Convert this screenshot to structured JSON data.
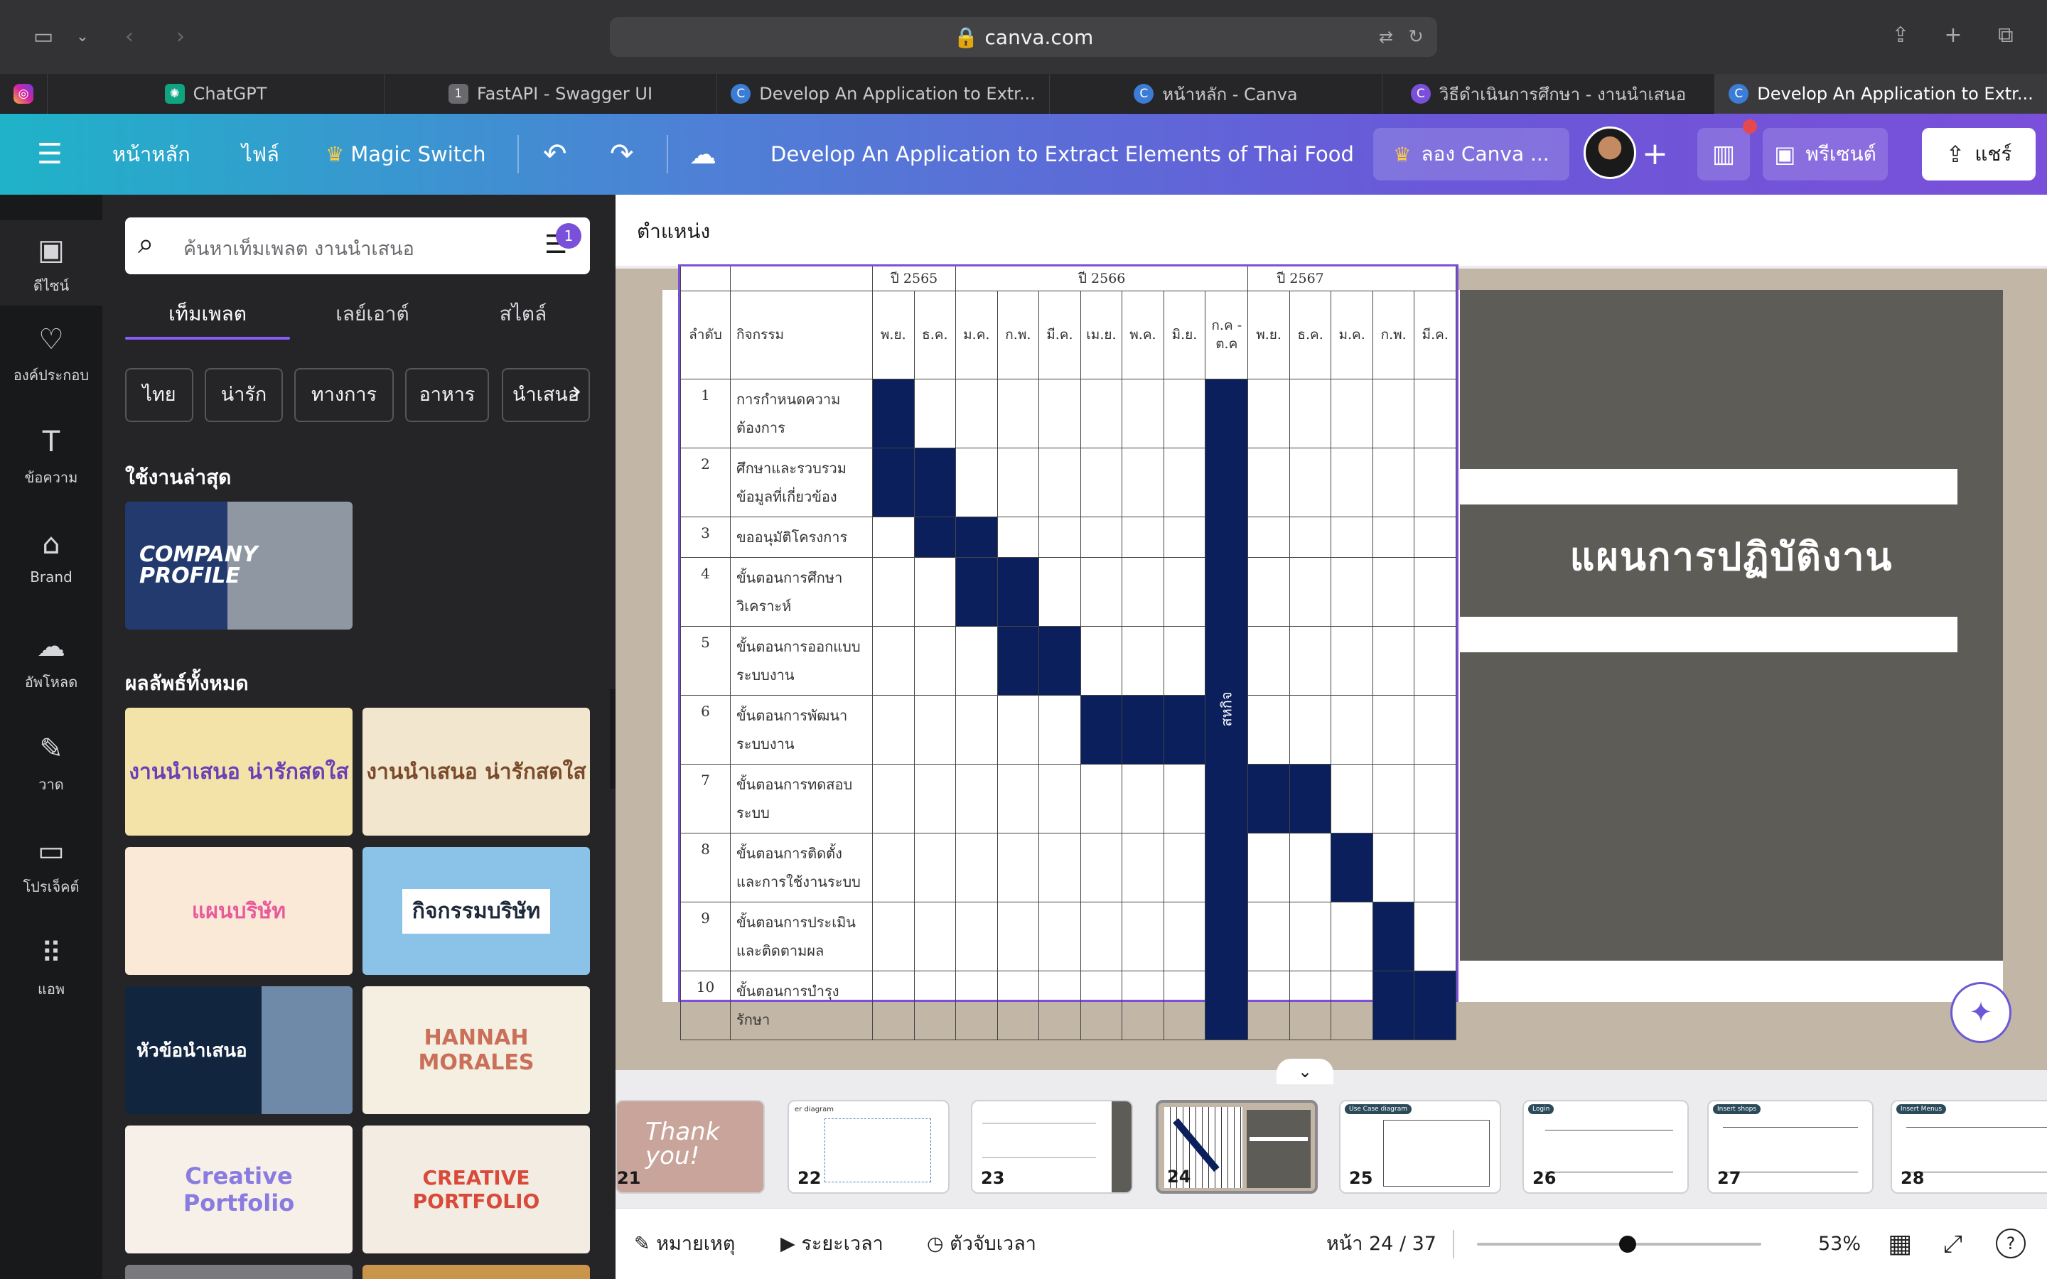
{
  "browser": {
    "url": "canva.com",
    "tabs": [
      {
        "label": "",
        "icon": "instagram-icon"
      },
      {
        "label": "ChatGPT",
        "icon": "chatgpt-icon"
      },
      {
        "label": "FastAPI - Swagger UI",
        "icon": "fastapi-icon"
      },
      {
        "label": "Develop An Application to Extr...",
        "icon": "canva-icon"
      },
      {
        "label": "หน้าหลัก - Canva",
        "icon": "canva-icon"
      },
      {
        "label": "วิธีดำเนินการศึกษา - งานนำเสนอ",
        "icon": "canva-icon"
      },
      {
        "label": "Develop An Application to Extr...",
        "icon": "canva-icon"
      }
    ]
  },
  "header": {
    "home": "หน้าหลัก",
    "file": "ไฟล์",
    "magic_switch": "Magic Switch",
    "doc_title": "Develop An Application to Extract Elements of Thai Food ...",
    "try_canva": "ลอง Canva ...",
    "present": "พรีเซนต์",
    "share": "แชร์",
    "accent": "#7a4fd9"
  },
  "rail": {
    "items": [
      {
        "label": "ดีไซน์",
        "icon": "design-icon"
      },
      {
        "label": "องค์ประกอบ",
        "icon": "elements-icon"
      },
      {
        "label": "ข้อความ",
        "icon": "text-icon"
      },
      {
        "label": "Brand",
        "icon": "brand-icon"
      },
      {
        "label": "อัพโหลด",
        "icon": "upload-icon"
      },
      {
        "label": "วาด",
        "icon": "draw-icon"
      },
      {
        "label": "โปรเจ็คต์",
        "icon": "projects-icon"
      },
      {
        "label": "แอพ",
        "icon": "apps-icon"
      }
    ]
  },
  "panel": {
    "search_placeholder": "ค้นหาเท็มเพลต งานนำเสนอ",
    "filter_badge": "1",
    "tabs": [
      "เท็มเพลต",
      "เลย์เอาต์",
      "สไตล์"
    ],
    "chips": [
      "ไทย",
      "น่ารัก",
      "ทางการ",
      "อาหาร",
      "นำเสนอ"
    ],
    "recent_heading": "ใช้งานล่าสุด",
    "recent_thumb": "COMPANY PROFILE",
    "all_heading": "ผลลัพธ์ทั้งหมด",
    "templates": [
      {
        "label": "งานนำเสนอ น่ารักสดใส",
        "bg": "#f3e3a8",
        "fg": "#6a3fb8"
      },
      {
        "label": "งานนำเสนอ น่ารักสดใส",
        "bg": "#f2e6cf",
        "fg": "#7a4a2a"
      },
      {
        "label": "แผนบริษัท",
        "bg": "#fbe9d8",
        "fg": "#e85a9a"
      },
      {
        "label": "กิจกรรมบริษัท",
        "bg": "#8bc2e8",
        "fg": "#1e2a3a"
      },
      {
        "label": "หัวข้อนำเสนอ",
        "bg": "#12253f",
        "fg": "#ffffff"
      },
      {
        "label": "HANNAH MORALES",
        "bg": "#f4efe0",
        "fg": "#c96f5a"
      },
      {
        "label": "Creative Portfolio",
        "bg": "#f6f0e8",
        "fg": "#8a7be0"
      },
      {
        "label": "CREATIVE PORTFOLIO",
        "bg": "#f3ece2",
        "fg": "#d84a3a"
      }
    ]
  },
  "canvas": {
    "position_label": "ตำแหน่ง",
    "slide_title": "แผนการปฏิบัติงาน",
    "gantt": {
      "years": [
        "ปี 2565",
        "ปี 2566",
        "ปี 2567"
      ],
      "col_order": "ลำดับ",
      "col_activity": "กิจกรรม",
      "months": [
        "พ.ย.",
        "ธ.ค.",
        "ม.ค.",
        "ก.พ.",
        "มี.ค.",
        "เม.ย.",
        "พ.ค.",
        "มิ.ย.",
        "ก.ค - ต.ค",
        "พ.ย.",
        "ธ.ค.",
        "ม.ค.",
        "ก.พ.",
        "มี.ค."
      ],
      "internship": "สหกิจ",
      "rows": [
        {
          "no": "1",
          "activity": "การกำหนดความต้องการ",
          "fill": [
            0
          ]
        },
        {
          "no": "2",
          "activity": "ศึกษาและรวบรวมข้อมูลที่เกี่ยวข้อง",
          "fill": [
            0,
            1
          ]
        },
        {
          "no": "3",
          "activity": "ขออนุมัติโครงการ",
          "fill": [
            1,
            2
          ]
        },
        {
          "no": "4",
          "activity": "ขั้นตอนการศึกษาวิเคราะห์",
          "fill": [
            2,
            3
          ]
        },
        {
          "no": "5",
          "activity": "ขั้นตอนการออกแบบระบบงาน",
          "fill": [
            3,
            4
          ]
        },
        {
          "no": "6",
          "activity": "ขั้นตอนการพัฒนาระบบงาน",
          "fill": [
            5,
            6,
            7
          ]
        },
        {
          "no": "7",
          "activity": "ขั้นตอนการทดสอบระบบ",
          "fill": [
            9,
            10
          ]
        },
        {
          "no": "8",
          "activity": "ขั้นตอนการติดตั้งและการใช้งานระบบ",
          "fill": [
            11
          ]
        },
        {
          "no": "9",
          "activity": "ขั้นตอนการประเมินและติดตามผล",
          "fill": [
            12
          ]
        },
        {
          "no": "10",
          "activity": "ขั้นตอนการบำรุงรักษา",
          "fill": [
            12,
            13
          ]
        }
      ]
    }
  },
  "filmstrip": {
    "pages": [
      {
        "num": "21",
        "label": "Thank you!"
      },
      {
        "num": "22",
        "label": "er diagram"
      },
      {
        "num": "23",
        "label": ""
      },
      {
        "num": "24",
        "label": ""
      },
      {
        "num": "25",
        "label": "Use Case diagram"
      },
      {
        "num": "26",
        "label": "Login"
      },
      {
        "num": "27",
        "label": "Insert shops"
      },
      {
        "num": "28",
        "label": "Insert Menus"
      }
    ]
  },
  "bottombar": {
    "notes": "หมายเหตุ",
    "duration": "ระยะเวลา",
    "timer": "ตัวจับเวลา",
    "page": "หน้า 24 / 37",
    "zoom": "53%",
    "zoom_level_fraction": 0.53
  }
}
